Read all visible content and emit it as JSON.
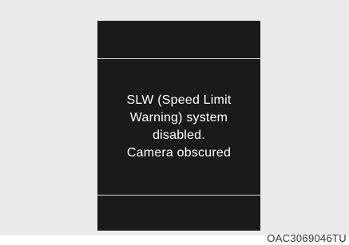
{
  "display": {
    "message_lines": [
      "SLW (Speed Limit",
      "Warning) system",
      "disabled.",
      "Camera obscured"
    ]
  },
  "figure_code": "OAC3069046TU"
}
